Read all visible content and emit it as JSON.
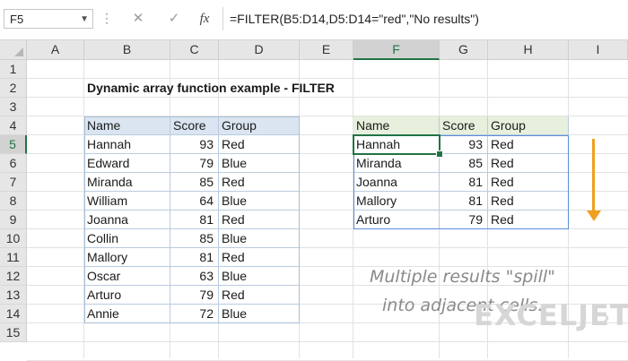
{
  "formula_bar": {
    "name_box": "F5",
    "cancel_icon": "✕",
    "enter_icon": "✓",
    "fx_label": "fx",
    "formula": "=FILTER(B5:D14,D5:D14=\"red\",\"No results\")"
  },
  "columns": [
    "A",
    "B",
    "C",
    "D",
    "E",
    "F",
    "G",
    "H",
    "I"
  ],
  "rows": [
    "1",
    "2",
    "3",
    "4",
    "5",
    "6",
    "7",
    "8",
    "9",
    "10",
    "11",
    "12",
    "13",
    "14",
    "15"
  ],
  "title": "Dynamic array function example - FILTER",
  "source_table": {
    "headers": [
      "Name",
      "Score",
      "Group"
    ],
    "rows": [
      [
        "Hannah",
        "93",
        "Red"
      ],
      [
        "Edward",
        "79",
        "Blue"
      ],
      [
        "Miranda",
        "85",
        "Red"
      ],
      [
        "William",
        "64",
        "Blue"
      ],
      [
        "Joanna",
        "81",
        "Red"
      ],
      [
        "Collin",
        "85",
        "Blue"
      ],
      [
        "Mallory",
        "81",
        "Red"
      ],
      [
        "Oscar",
        "63",
        "Blue"
      ],
      [
        "Arturo",
        "79",
        "Red"
      ],
      [
        "Annie",
        "72",
        "Blue"
      ]
    ]
  },
  "result_table": {
    "headers": [
      "Name",
      "Score",
      "Group"
    ],
    "rows": [
      [
        "Hannah",
        "93",
        "Red"
      ],
      [
        "Miranda",
        "85",
        "Red"
      ],
      [
        "Joanna",
        "81",
        "Red"
      ],
      [
        "Mallory",
        "81",
        "Red"
      ],
      [
        "Arturo",
        "79",
        "Red"
      ]
    ]
  },
  "note": {
    "line1": "Multiple results \"spill\"",
    "line2": "into adjacent cells."
  },
  "logo": "EXCELJET",
  "colors": {
    "selection": "#217346",
    "arrow": "#f0a020",
    "source_header": "#dae5f1",
    "result_header": "#e7f0dd"
  }
}
